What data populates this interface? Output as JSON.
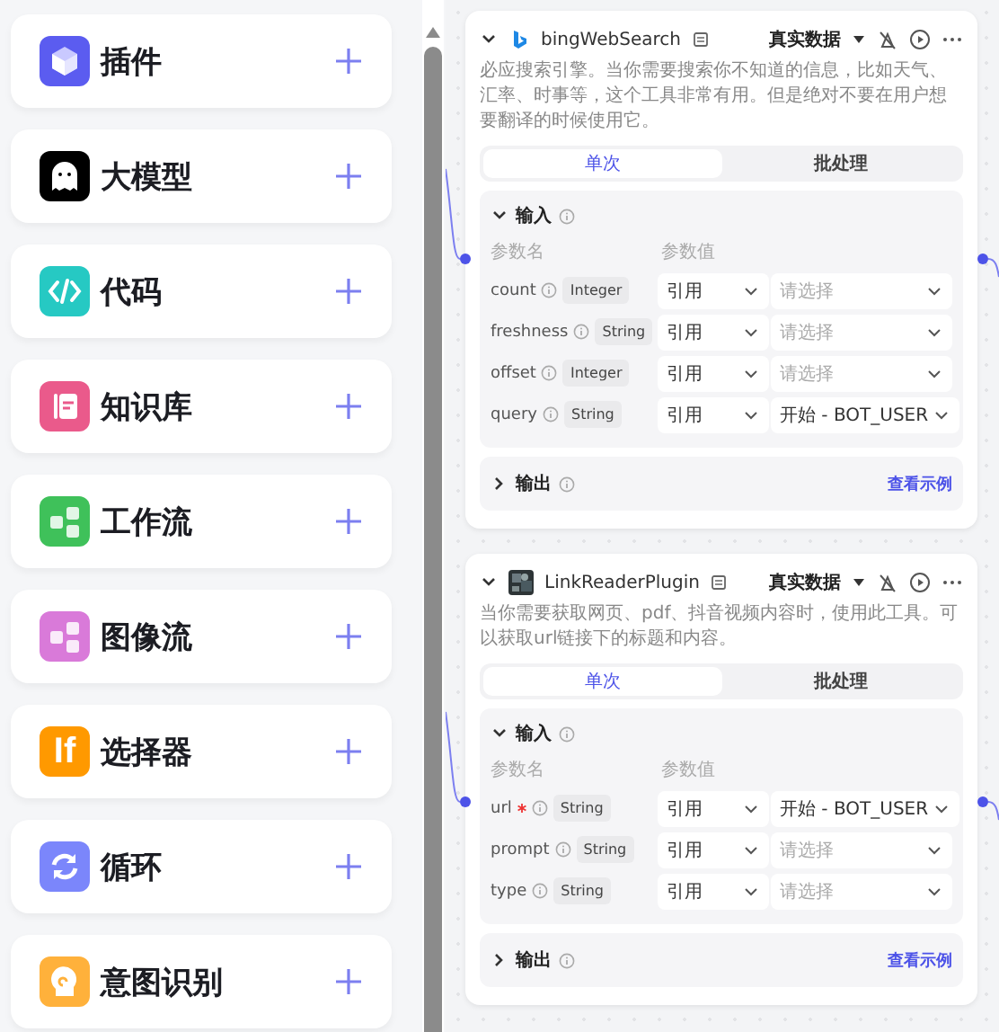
{
  "sidebar": {
    "items": [
      {
        "label": "插件",
        "kind": "cube",
        "color": "#5b5cf0"
      },
      {
        "label": "大模型",
        "kind": "ghost",
        "color": "#000000"
      },
      {
        "label": "代码",
        "kind": "code",
        "color": "#26c9c3"
      },
      {
        "label": "知识库",
        "kind": "book",
        "color": "#ea5a8b"
      },
      {
        "label": "工作流",
        "kind": "flow",
        "color": "#3fc15a"
      },
      {
        "label": "图像流",
        "kind": "flow",
        "color": "#d97ad9"
      },
      {
        "label": "选择器",
        "kind": "text",
        "icon_text": "If",
        "color": "#ff9900"
      },
      {
        "label": "循环",
        "kind": "loop",
        "color": "#7b86fb"
      },
      {
        "label": "意图识别",
        "kind": "head",
        "color": "#ffb13b"
      }
    ]
  },
  "nodes": [
    {
      "title": "bingWebSearch",
      "kind": "bing",
      "description": "必应搜索引擎。当你需要搜索你不知道的信息，比如天气、汇率、时事等，这个工具非常有用。但是绝对不要在用户想要翻译的时候使用它。",
      "data_source": "真实数据",
      "tabs": [
        {
          "label": "单次",
          "selected": true
        },
        {
          "label": "批处理",
          "selected": false
        }
      ],
      "input": {
        "title": "输入",
        "expanded": true,
        "columns": [
          "参数名",
          "参数值"
        ],
        "params": [
          {
            "name": "count",
            "required": false,
            "type": "Integer",
            "source": "引用",
            "placeholder": "请选择"
          },
          {
            "name": "freshness",
            "required": false,
            "type": "String",
            "source": "引用",
            "placeholder": "请选择"
          },
          {
            "name": "offset",
            "required": false,
            "type": "Integer",
            "source": "引用",
            "placeholder": "请选择"
          },
          {
            "name": "query",
            "required": false,
            "type": "String",
            "source": "引用",
            "value": "开始 - BOT_USER"
          }
        ]
      },
      "output": {
        "title": "输出",
        "expanded": false,
        "link": "查看示例"
      }
    },
    {
      "title": "LinkReaderPlugin",
      "kind": "picture",
      "description": "当你需要获取网页、pdf、抖音视频内容时，使用此工具。可以获取url链接下的标题和内容。",
      "data_source": "真实数据",
      "tabs": [
        {
          "label": "单次",
          "selected": true
        },
        {
          "label": "批处理",
          "selected": false
        }
      ],
      "input": {
        "title": "输入",
        "expanded": true,
        "columns": [
          "参数名",
          "参数值"
        ],
        "params": [
          {
            "name": "url",
            "required": true,
            "type": "String",
            "source": "引用",
            "value": "开始 - BOT_USER"
          },
          {
            "name": "prompt",
            "required": false,
            "type": "String",
            "source": "引用",
            "placeholder": "请选择"
          },
          {
            "name": "type",
            "required": false,
            "type": "String",
            "source": "引用",
            "placeholder": "请选择"
          }
        ]
      },
      "output": {
        "title": "输出",
        "expanded": false,
        "link": "查看示例"
      }
    }
  ]
}
